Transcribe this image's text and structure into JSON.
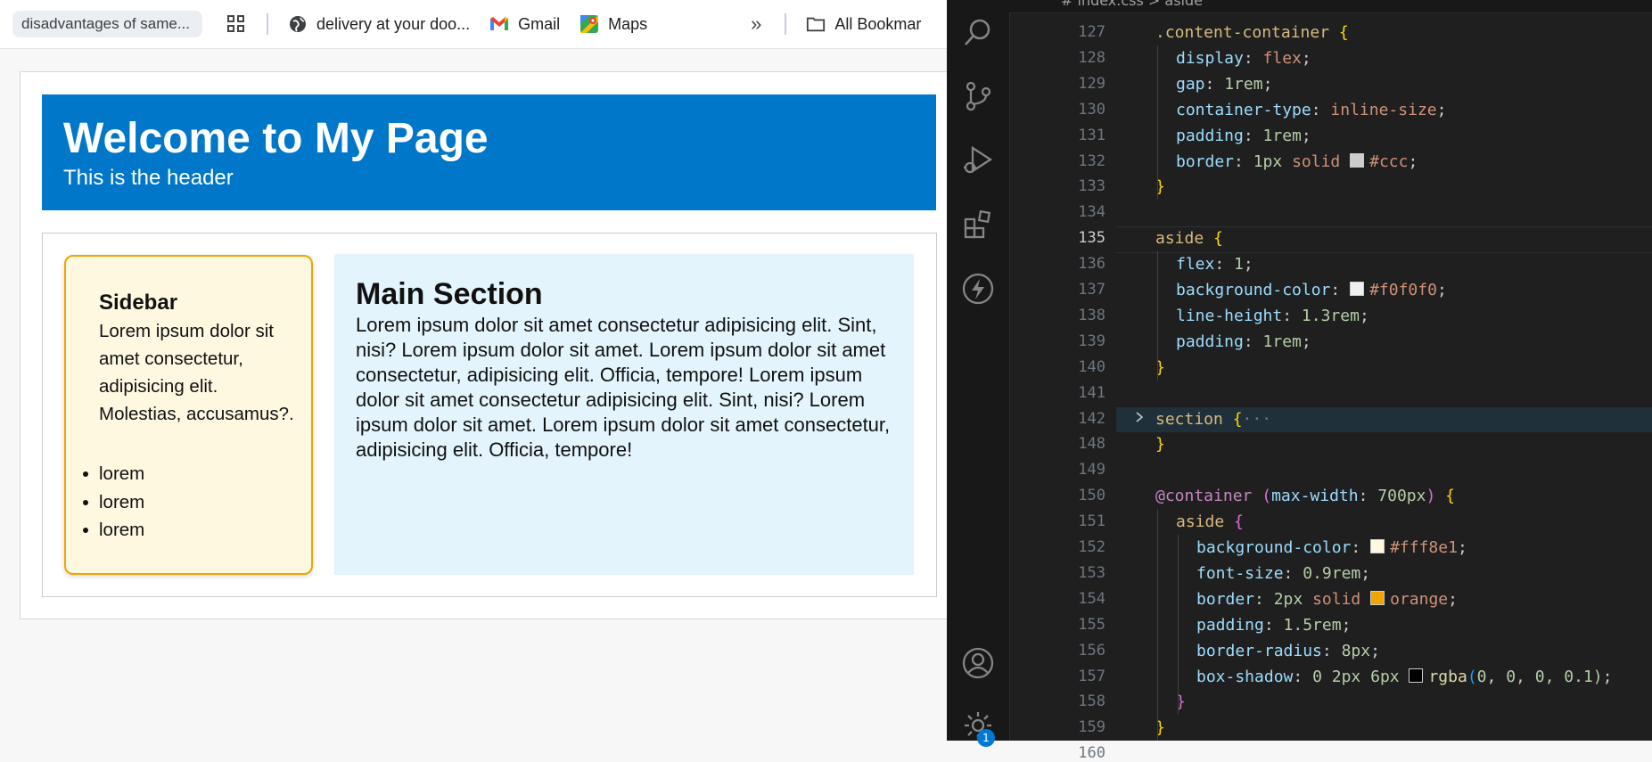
{
  "bookmarks": {
    "pill_label": "disadvantages of same...",
    "items": [
      {
        "label": "delivery at your doo...",
        "icon": "globe-icon"
      },
      {
        "label": "Gmail",
        "icon": "gmail-icon"
      },
      {
        "label": "Maps",
        "icon": "maps-icon"
      }
    ],
    "overflow": "»",
    "all_bookmarks": "All Bookmar"
  },
  "site": {
    "header_title": "Welcome to My Page",
    "header_sub": "This is the header",
    "aside": {
      "title": "Sidebar",
      "text": "Lorem ipsum dolor sit amet consectetur, adipisicing elit. Molestias, accusamus?.",
      "list": [
        "lorem",
        "lorem",
        "lorem"
      ]
    },
    "main": {
      "title": "Main Section",
      "text": "Lorem ipsum dolor sit amet consectetur adipisicing elit. Sint, nisi? Lorem ipsum dolor sit amet. Lorem ipsum dolor sit amet consectetur, adipisicing elit. Officia, tempore! Lorem ipsum dolor sit amet consectetur adipisicing elit. Sint, nisi? Lorem ipsum dolor sit amet. Lorem ipsum dolor sit amet consectetur, adipisicing elit. Officia, tempore!"
    }
  },
  "editor": {
    "breadcrumb": "# index.css  >  aside",
    "notification_count": "1",
    "active_line": "135",
    "lines": [
      {
        "n": "127",
        "code": ".content-container {"
      },
      {
        "n": "128",
        "code": "display: flex;"
      },
      {
        "n": "129",
        "code": "gap: 1rem;"
      },
      {
        "n": "130",
        "code": "container-type: inline-size;"
      },
      {
        "n": "131",
        "code": "padding: 1rem;"
      },
      {
        "n": "132",
        "code": "border: 1px solid #ccc;"
      },
      {
        "n": "133",
        "code": "}"
      },
      {
        "n": "134",
        "code": ""
      },
      {
        "n": "135",
        "code": "aside {"
      },
      {
        "n": "136",
        "code": "flex: 1;"
      },
      {
        "n": "137",
        "code": "background-color: #f0f0f0;"
      },
      {
        "n": "138",
        "code": "line-height: 1.3rem;"
      },
      {
        "n": "139",
        "code": "padding: 1rem;"
      },
      {
        "n": "140",
        "code": "}"
      },
      {
        "n": "141",
        "code": ""
      },
      {
        "n": "142",
        "code": "section {···"
      },
      {
        "n": "148",
        "code": "}"
      },
      {
        "n": "149",
        "code": ""
      },
      {
        "n": "150",
        "code": "@container (max-width: 700px) {"
      },
      {
        "n": "151",
        "code": "aside {"
      },
      {
        "n": "152",
        "code": "background-color: #fff8e1;"
      },
      {
        "n": "153",
        "code": "font-size: 0.9rem;"
      },
      {
        "n": "154",
        "code": "border: 2px solid orange;"
      },
      {
        "n": "155",
        "code": "padding: 1.5rem;"
      },
      {
        "n": "156",
        "code": "border-radius: 8px;"
      },
      {
        "n": "157",
        "code": "box-shadow: 0 2px 6px rgba(0, 0, 0, 0.1);"
      },
      {
        "n": "158",
        "code": "}"
      },
      {
        "n": "159",
        "code": "}"
      },
      {
        "n": "160",
        "code": ""
      }
    ],
    "colors": {
      "swatch_ccc": "#cccccc",
      "swatch_f0f0f0": "#f0f0f0",
      "swatch_fff8e1": "#fff8e1",
      "swatch_orange": "#f0a500",
      "swatch_rgba": "#000000"
    }
  }
}
